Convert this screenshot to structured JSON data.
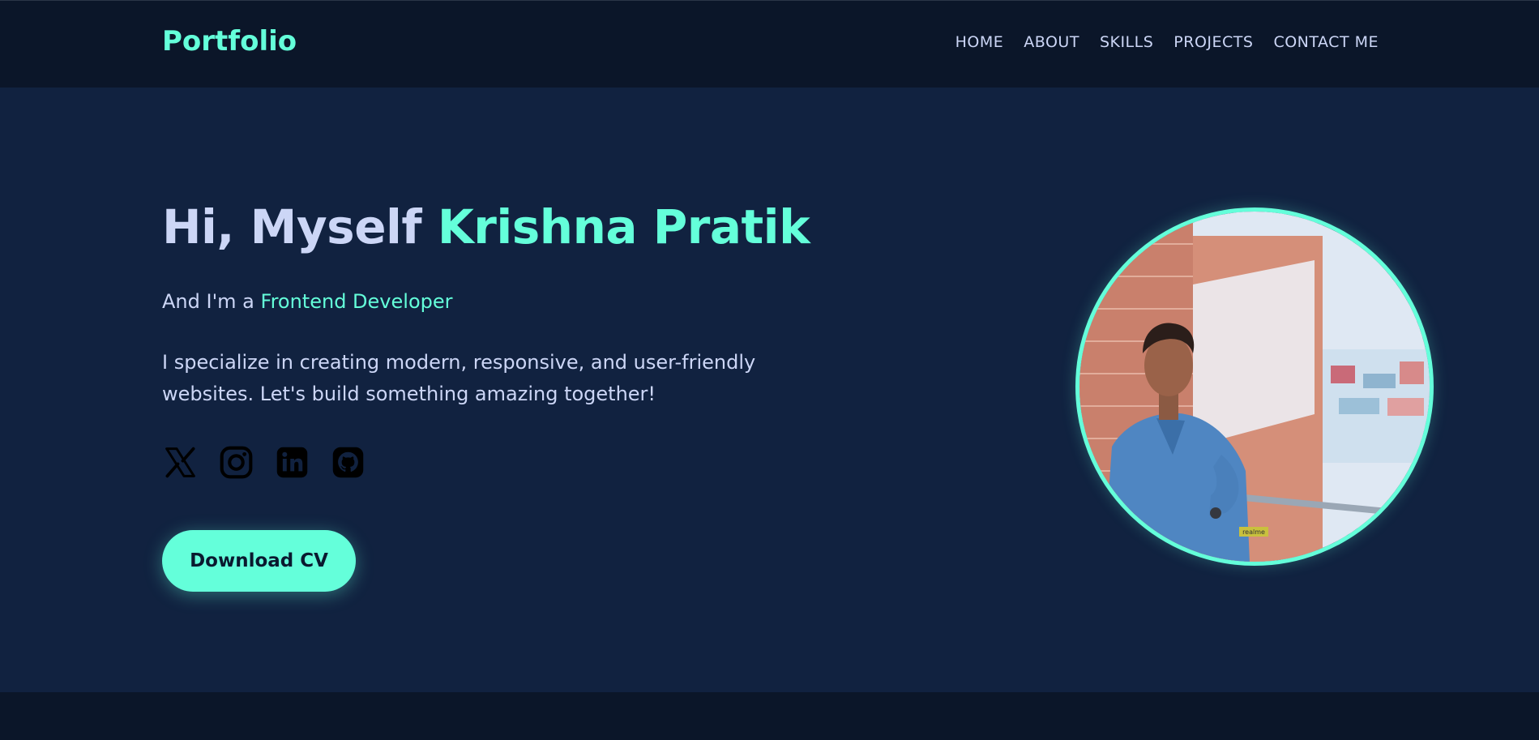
{
  "navbar": {
    "brand": "Portfolio",
    "links": [
      "HOME",
      "ABOUT",
      "SKILLS",
      "PROJECTS",
      "CONTACT ME"
    ]
  },
  "hero": {
    "title_prefix": "Hi, Myself ",
    "title_name": "Krishna Pratik",
    "subtitle_prefix": "And I'm a ",
    "subtitle_role": "Frontend Developer",
    "description": "I specialize in creating modern, responsive, and user-friendly websites. Let's build something amazing together!",
    "socials": [
      "x-icon",
      "instagram-icon",
      "linkedin-icon",
      "github-icon"
    ],
    "cta_label": "Download CV",
    "photo_badge": "realme"
  },
  "colors": {
    "accent": "#64ffda",
    "text": "#ccd6f6",
    "background": "#112240",
    "nav_background": "#0b1629"
  }
}
